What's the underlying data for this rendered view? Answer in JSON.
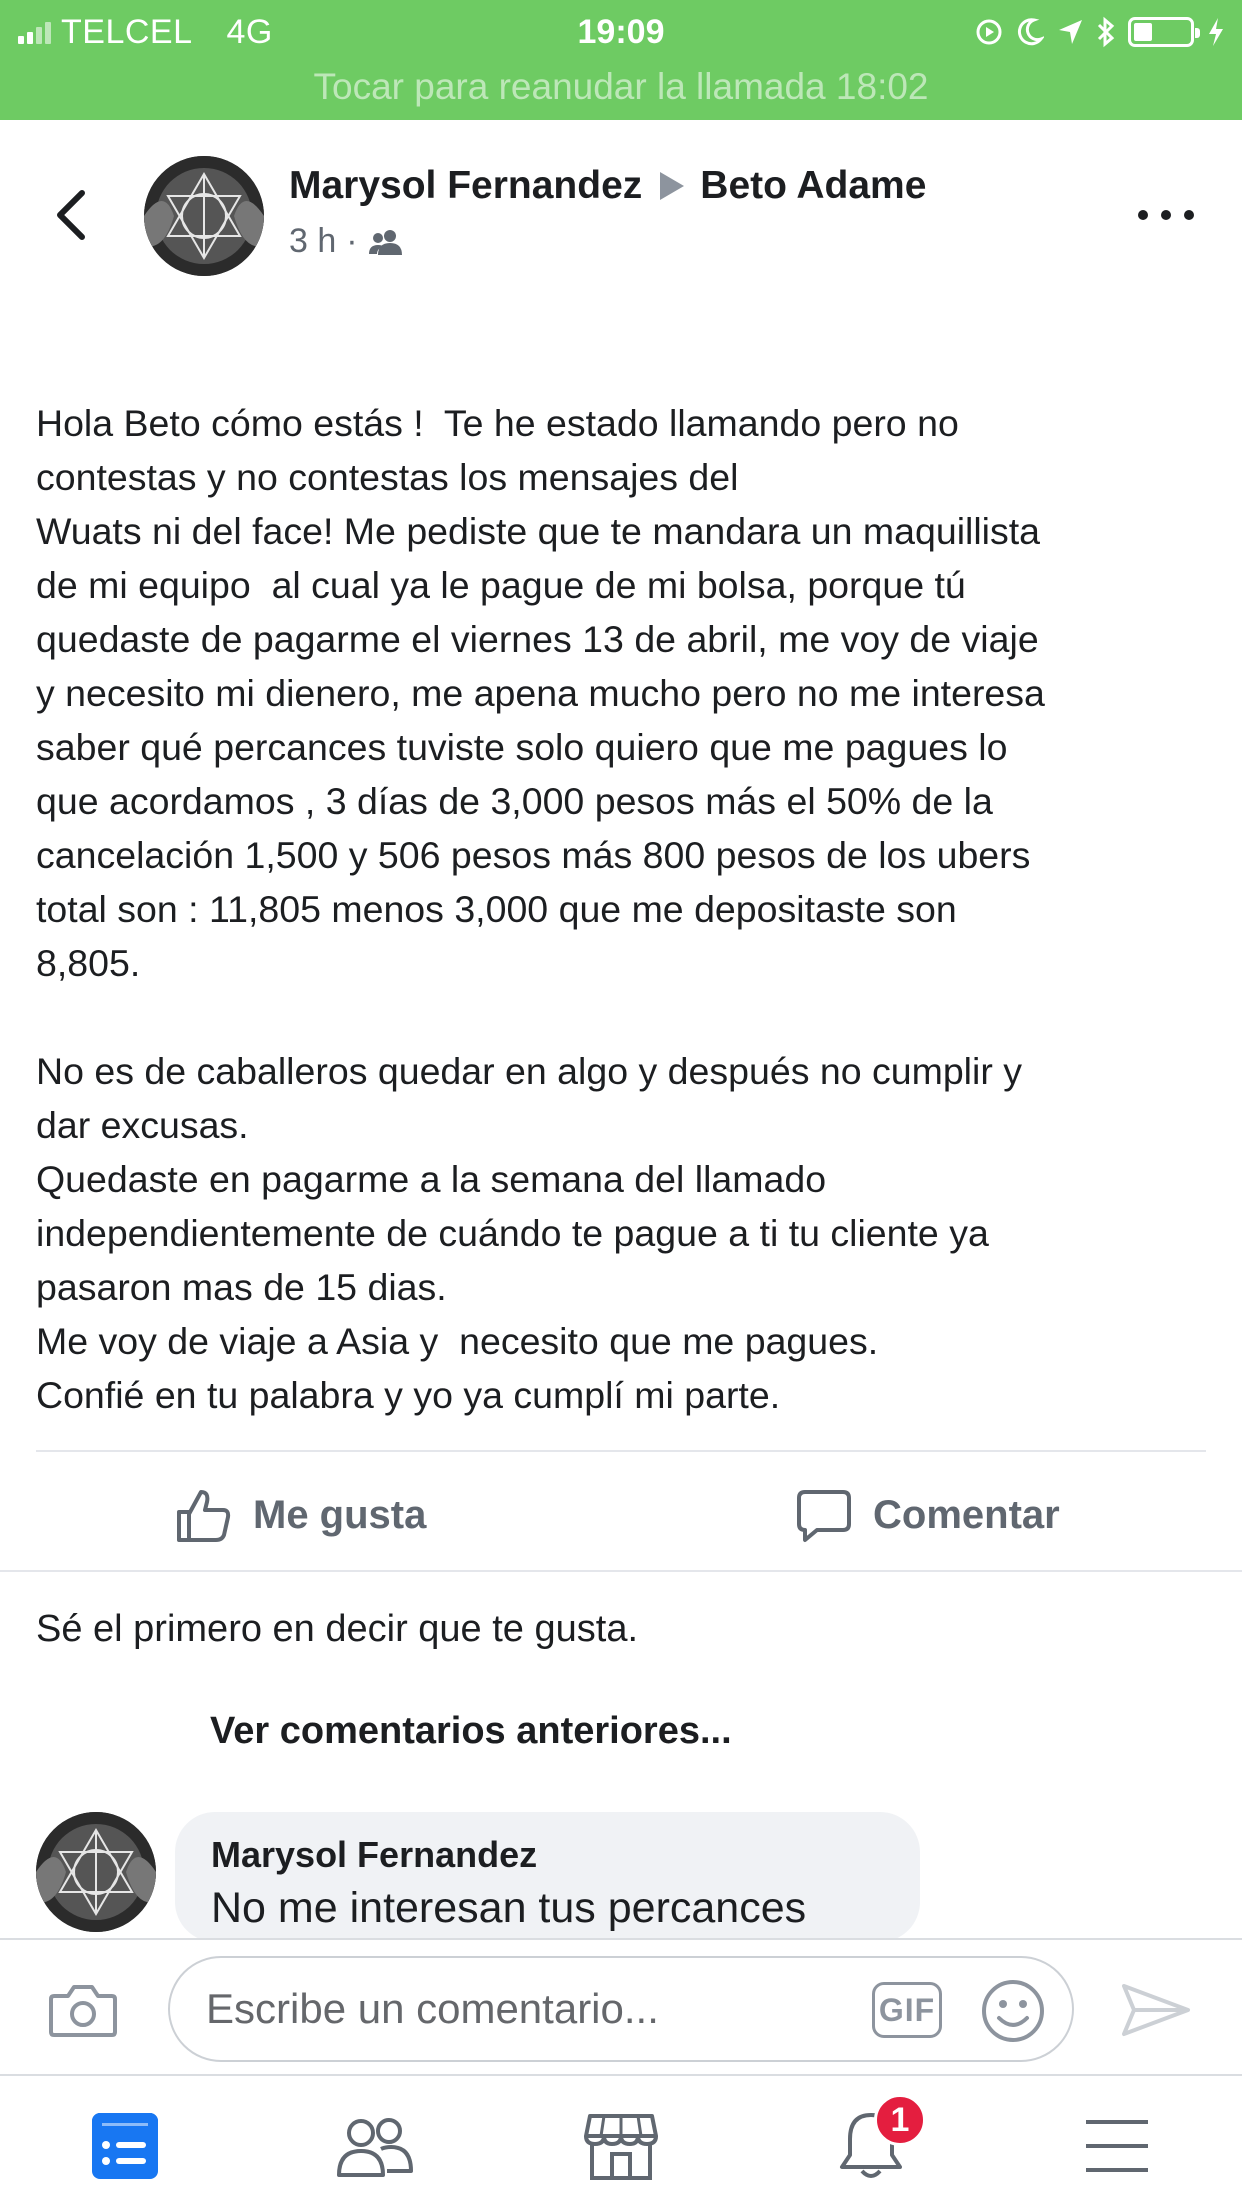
{
  "status_bar": {
    "carrier": "TELCEL",
    "network": "4G",
    "time": "19:09",
    "call_banner": "Tocar para reanudar la llamada 18:02"
  },
  "post": {
    "author": "Marysol Fernandez",
    "recipient": "Beto Adame",
    "time_ago": "3 h",
    "separator": "·",
    "audience_icon": "friends-icon",
    "body": "Hola Beto cómo estás !  Te he estado llamando pero no\ncontestas y no contestas los mensajes del\nWuats ni del face! Me pediste que te mandara un maquillista\nde mi equipo  al cual ya le pague de mi bolsa, porque tú\nquedaste de pagarme el viernes 13 de abril, me voy de viaje\ny necesito mi dienero, me apena mucho pero no me interesa\nsaber qué percances tuviste solo quiero que me pagues lo\nque acordamos , 3 días de 3,000 pesos más el 50% de la\ncancelación 1,500 y 506 pesos más 800 pesos de los ubers\ntotal son : 11,805 menos 3,000 que me depositaste son\n8,805.\n\nNo es de caballeros quedar en algo y después no cumplir y\ndar excusas.\nQuedaste en pagarme a la semana del llamado\nindependientemente de cuándo te pague a ti tu cliente ya\npasaron mas de 15 dias.\nMe voy de viaje a Asia y  necesito que me pagues.\nConfié en tu palabra y yo ya cumplí mi parte."
  },
  "actions": {
    "like_label": "Me gusta",
    "comment_label": "Comentar"
  },
  "reactions": {
    "first_like_text": "Sé el primero en decir que te gusta."
  },
  "comments": {
    "view_previous": "Ver comentarios anteriores...",
    "items": [
      {
        "author": "Marysol Fernandez",
        "text": "No me interesan tus percances"
      }
    ]
  },
  "composer": {
    "placeholder": "Escribe un comentario...",
    "gif_label": "GIF"
  },
  "tab_bar": {
    "tabs": [
      "news-feed-icon",
      "friends-icon",
      "marketplace-icon",
      "notifications-icon",
      "menu-icon"
    ],
    "notifications_badge": "1"
  },
  "colors": {
    "status_bar_bg": "#6ecb63",
    "active_tab": "#1877f2",
    "badge": "#e41e3f"
  }
}
